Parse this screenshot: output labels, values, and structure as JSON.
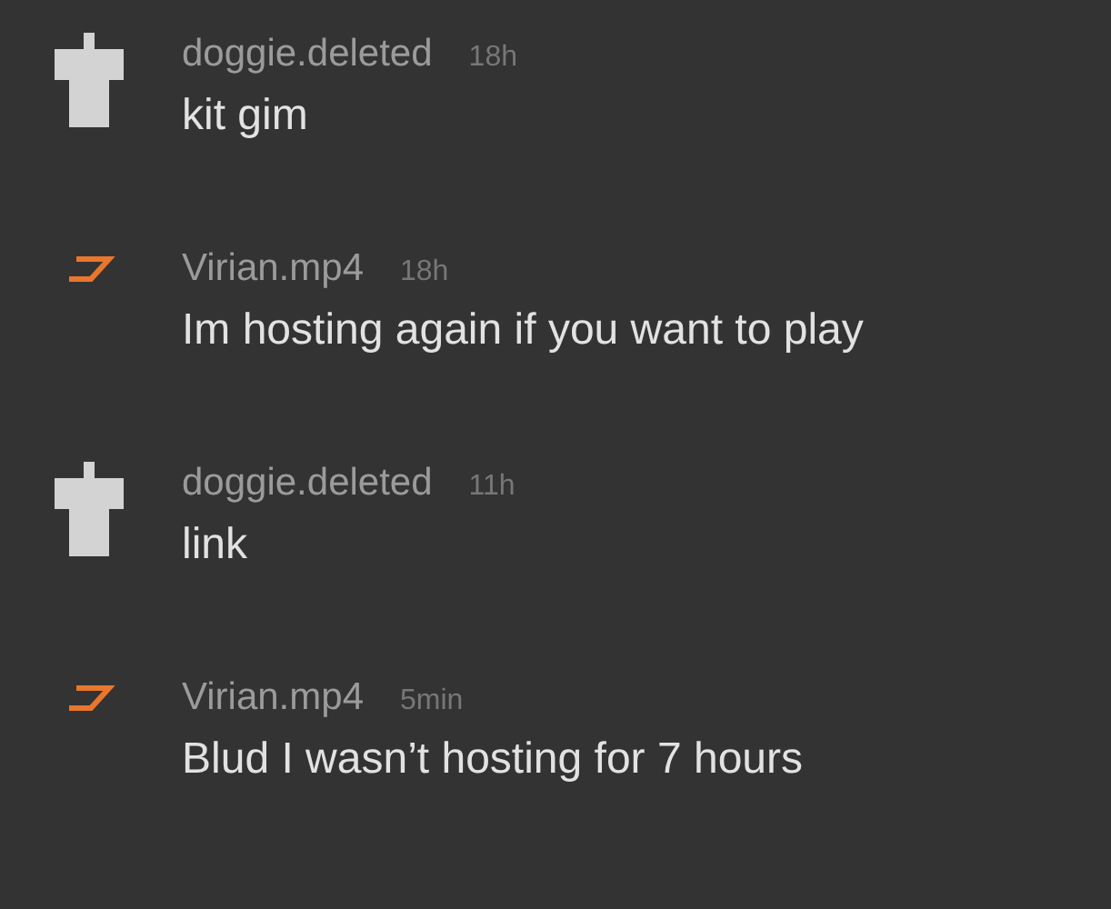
{
  "messages": [
    {
      "kind": "figure",
      "author": "doggie.deleted",
      "time": "18h",
      "text": "kit gim"
    },
    {
      "kind": "zigzag",
      "author": "Virian.mp4",
      "time": "18h",
      "text": "Im hosting again if you want to play"
    },
    {
      "kind": "figure",
      "author": "doggie.deleted",
      "time": "11h",
      "text": "link"
    },
    {
      "kind": "zigzag",
      "author": "Virian.mp4",
      "time": "5min",
      "text": "Blud I wasn’t hosting for 7 hours"
    }
  ]
}
